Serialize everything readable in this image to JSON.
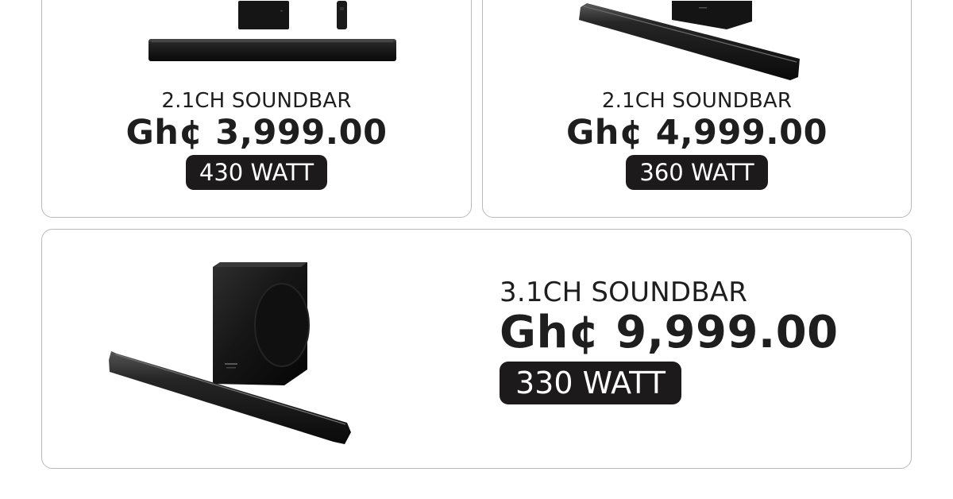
{
  "products": [
    {
      "name": "2.1CH SOUNDBAR",
      "price": "Gh¢ 3,999.00",
      "power": "430 WATT"
    },
    {
      "name": "2.1CH SOUNDBAR",
      "price": "Gh¢ 4,999.00",
      "power": "360 WATT"
    },
    {
      "name": "3.1CH SOUNDBAR",
      "price": "Gh¢ 9,999.00",
      "power": "330 WATT"
    }
  ],
  "colors": {
    "card_border": "#b9b9b9",
    "text": "#1e1e1e",
    "badge_background": "#1c1a1a",
    "badge_text": "#ffffff",
    "product_black": "#151515"
  }
}
